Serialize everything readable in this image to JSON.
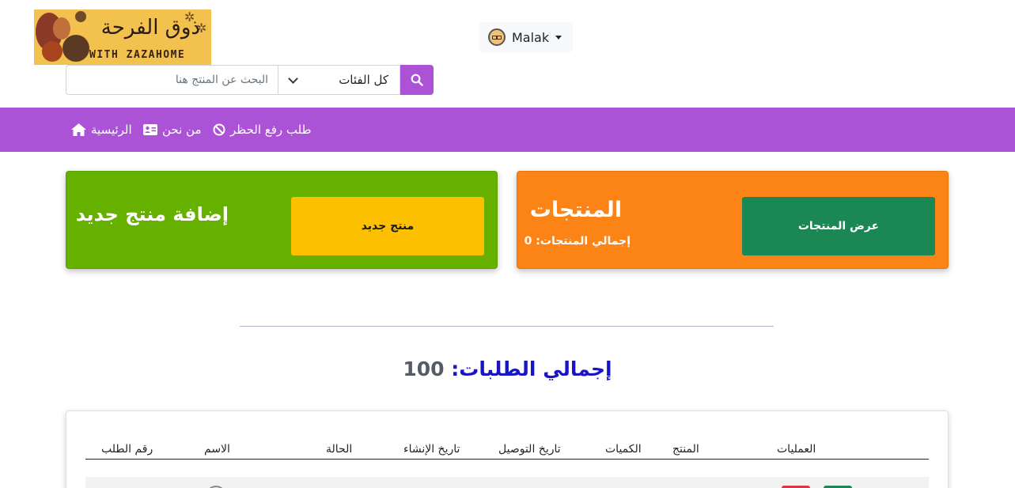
{
  "header": {
    "logo_text_ar": "ذوق الفرحة",
    "logo_text_en": "WITH ZAZAHOME",
    "user_name": "Malak",
    "search": {
      "placeholder": "البحث عن المنتج هنا",
      "category_selected": "كل الفئات"
    }
  },
  "nav": {
    "home": "الرئيسية",
    "about": "من نحن",
    "unban": "طلب رفع الحظر"
  },
  "cards": {
    "add_product": {
      "title": "إضافة منتج جديد",
      "button": "منتج جديد"
    },
    "products": {
      "title": "المنتجات",
      "total_label": "إجمالي المنتجات: 0",
      "button": "عرض المنتجات"
    }
  },
  "orders": {
    "total_label": "إجمالي الطلبات:",
    "total_value": "100"
  },
  "table": {
    "headers": {
      "order_no": "رقم الطلب",
      "name": "الاسم",
      "status": "الحالة",
      "created": "تاريخ الإنشاء",
      "delivery": "تاريخ التوصيل",
      "quantities": "الكميات",
      "product": "المنتج",
      "actions": "العمليات"
    }
  },
  "colors": {
    "accent": "#ab52d6",
    "green_card": "#66b000",
    "orange_card": "#fc8416",
    "yellow_button": "#fcc000",
    "dark_green_button": "#1a8754",
    "total_blue": "#1a14c8"
  },
  "icons": {
    "home": "home-icon",
    "about": "id-card-icon",
    "unban": "ban-icon",
    "search": "search-icon"
  }
}
